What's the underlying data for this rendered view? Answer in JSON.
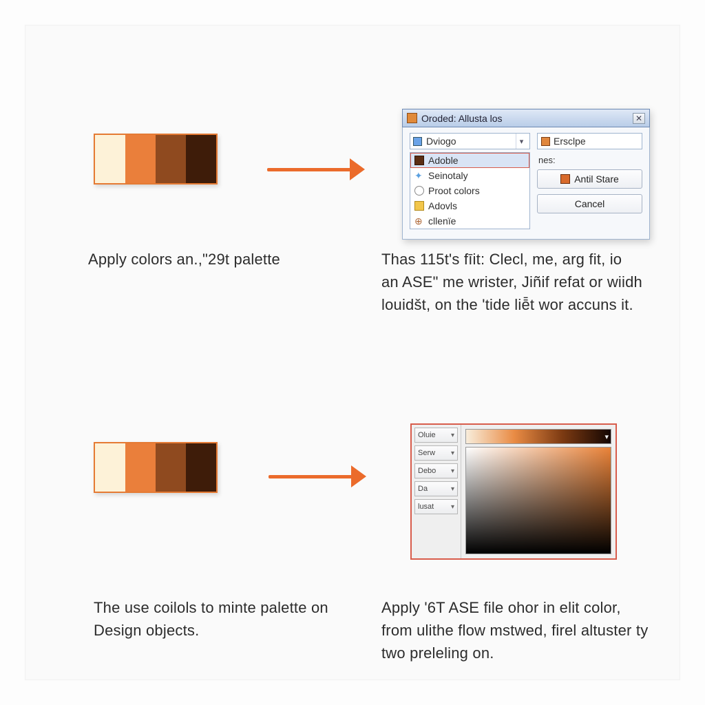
{
  "palette": {
    "colors": [
      "#fdf2d8",
      "#ea7f3b",
      "#8f4a1f",
      "#3e1c09"
    ]
  },
  "captions": {
    "top_left": "Apply colors an.,\"29t palette",
    "top_right": "Thas 115t's fīit: Clecl, me, arg fit, io an ASE\" me wrister, Jiñif refat or wiidh louidšt, on the 'tide liē̄t wor accuns it.",
    "bottom_left": "The use coilols to minte palette on Design objects.",
    "bottom_right": "Apply '6T ASE file ohor in elit color, from ulithe flow mstwed, firel altuster ty two preleling on."
  },
  "dialog": {
    "title": "Oroded: Allusta los",
    "combo_value": "Dviogo",
    "list": [
      {
        "label": "Adoble",
        "selected": true
      },
      {
        "label": "Seinotaly",
        "selected": false
      },
      {
        "label": "Proot colors",
        "selected": false
      },
      {
        "label": "Adovls",
        "selected": false
      },
      {
        "label": "cllenïe",
        "selected": false
      }
    ],
    "right_label": "nes:",
    "right_top_value": "Ersclpe",
    "button_primary": "Antil Stare",
    "button_cancel": "Cancel"
  },
  "color_panel": {
    "tabs": [
      "Oluie",
      "Serw",
      "Debo",
      "Da",
      "lusat"
    ]
  }
}
